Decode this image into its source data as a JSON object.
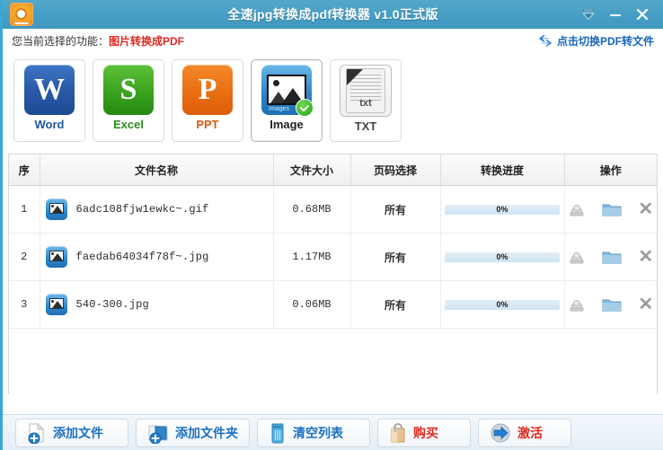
{
  "window": {
    "title": "全速jpg转换成pdf转换器 v1.0正式版",
    "logo_icon": "app-logo-icon",
    "controls": {
      "tray_label": "▼",
      "minimize_label": "—",
      "close_label": "✕"
    }
  },
  "func_bar": {
    "label": "您当前选择的功能：",
    "value": "图片转换成PDF",
    "value_color": "#e0281e",
    "switch_link": "点击切换PDF转文件",
    "switch_icon": "swap-arrows-icon"
  },
  "formats": [
    {
      "id": "word",
      "label": "Word",
      "glyph": "W",
      "icon": "word-icon",
      "selected": false
    },
    {
      "id": "excel",
      "label": "Excel",
      "glyph": "S",
      "icon": "excel-icon",
      "selected": false
    },
    {
      "id": "ppt",
      "label": "PPT",
      "glyph": "P",
      "icon": "ppt-icon",
      "selected": false
    },
    {
      "id": "image",
      "label": "Image",
      "glyph": "",
      "icon": "image-icon",
      "sub": "Images",
      "selected": true
    },
    {
      "id": "txt",
      "label": "TXT",
      "glyph": "txt",
      "icon": "txt-icon",
      "selected": false
    }
  ],
  "table": {
    "headers": [
      "序",
      "文件名称",
      "文件大小",
      "页码选择",
      "转换进度",
      "操作"
    ],
    "rows": [
      {
        "index": "1",
        "name": "6adc108fjw1ewkc~.gif",
        "size": "0.68MB",
        "pages": "所有",
        "progress_text": "0%",
        "progress_value": 0
      },
      {
        "index": "2",
        "name": "faedab64034f78f~.jpg",
        "size": "1.17MB",
        "pages": "所有",
        "progress_text": "0%",
        "progress_value": 0
      },
      {
        "index": "3",
        "name": "540-300.jpg",
        "size": "0.06MB",
        "pages": "所有",
        "progress_text": "0%",
        "progress_value": 0
      }
    ],
    "row_actions": {
      "preview_icon": "preview-icon",
      "folder_icon": "open-folder-icon",
      "remove_icon": "remove-icon",
      "remove_label": "✕"
    }
  },
  "bottom_bar": {
    "buttons": [
      {
        "id": "add-file",
        "label": "添加文件",
        "icon": "add-file-icon",
        "color": "#1b6fc2"
      },
      {
        "id": "add-folder",
        "label": "添加文件夹",
        "icon": "add-folder-icon",
        "color": "#1b6fc2"
      },
      {
        "id": "clear-list",
        "label": "清空列表",
        "icon": "trash-icon",
        "color": "#1b6fc2"
      },
      {
        "id": "buy",
        "label": "购买",
        "icon": "bag-icon",
        "color": "#e0281e"
      },
      {
        "id": "activate",
        "label": "激活",
        "icon": "activate-icon",
        "color": "#e0281e"
      }
    ]
  },
  "colors": {
    "titlebar": "#49a0c6",
    "accent_blue": "#1b6fc2",
    "accent_red": "#e0281e",
    "progress_fill": "#cfe4f3",
    "panel_bg": "#ffffff"
  }
}
